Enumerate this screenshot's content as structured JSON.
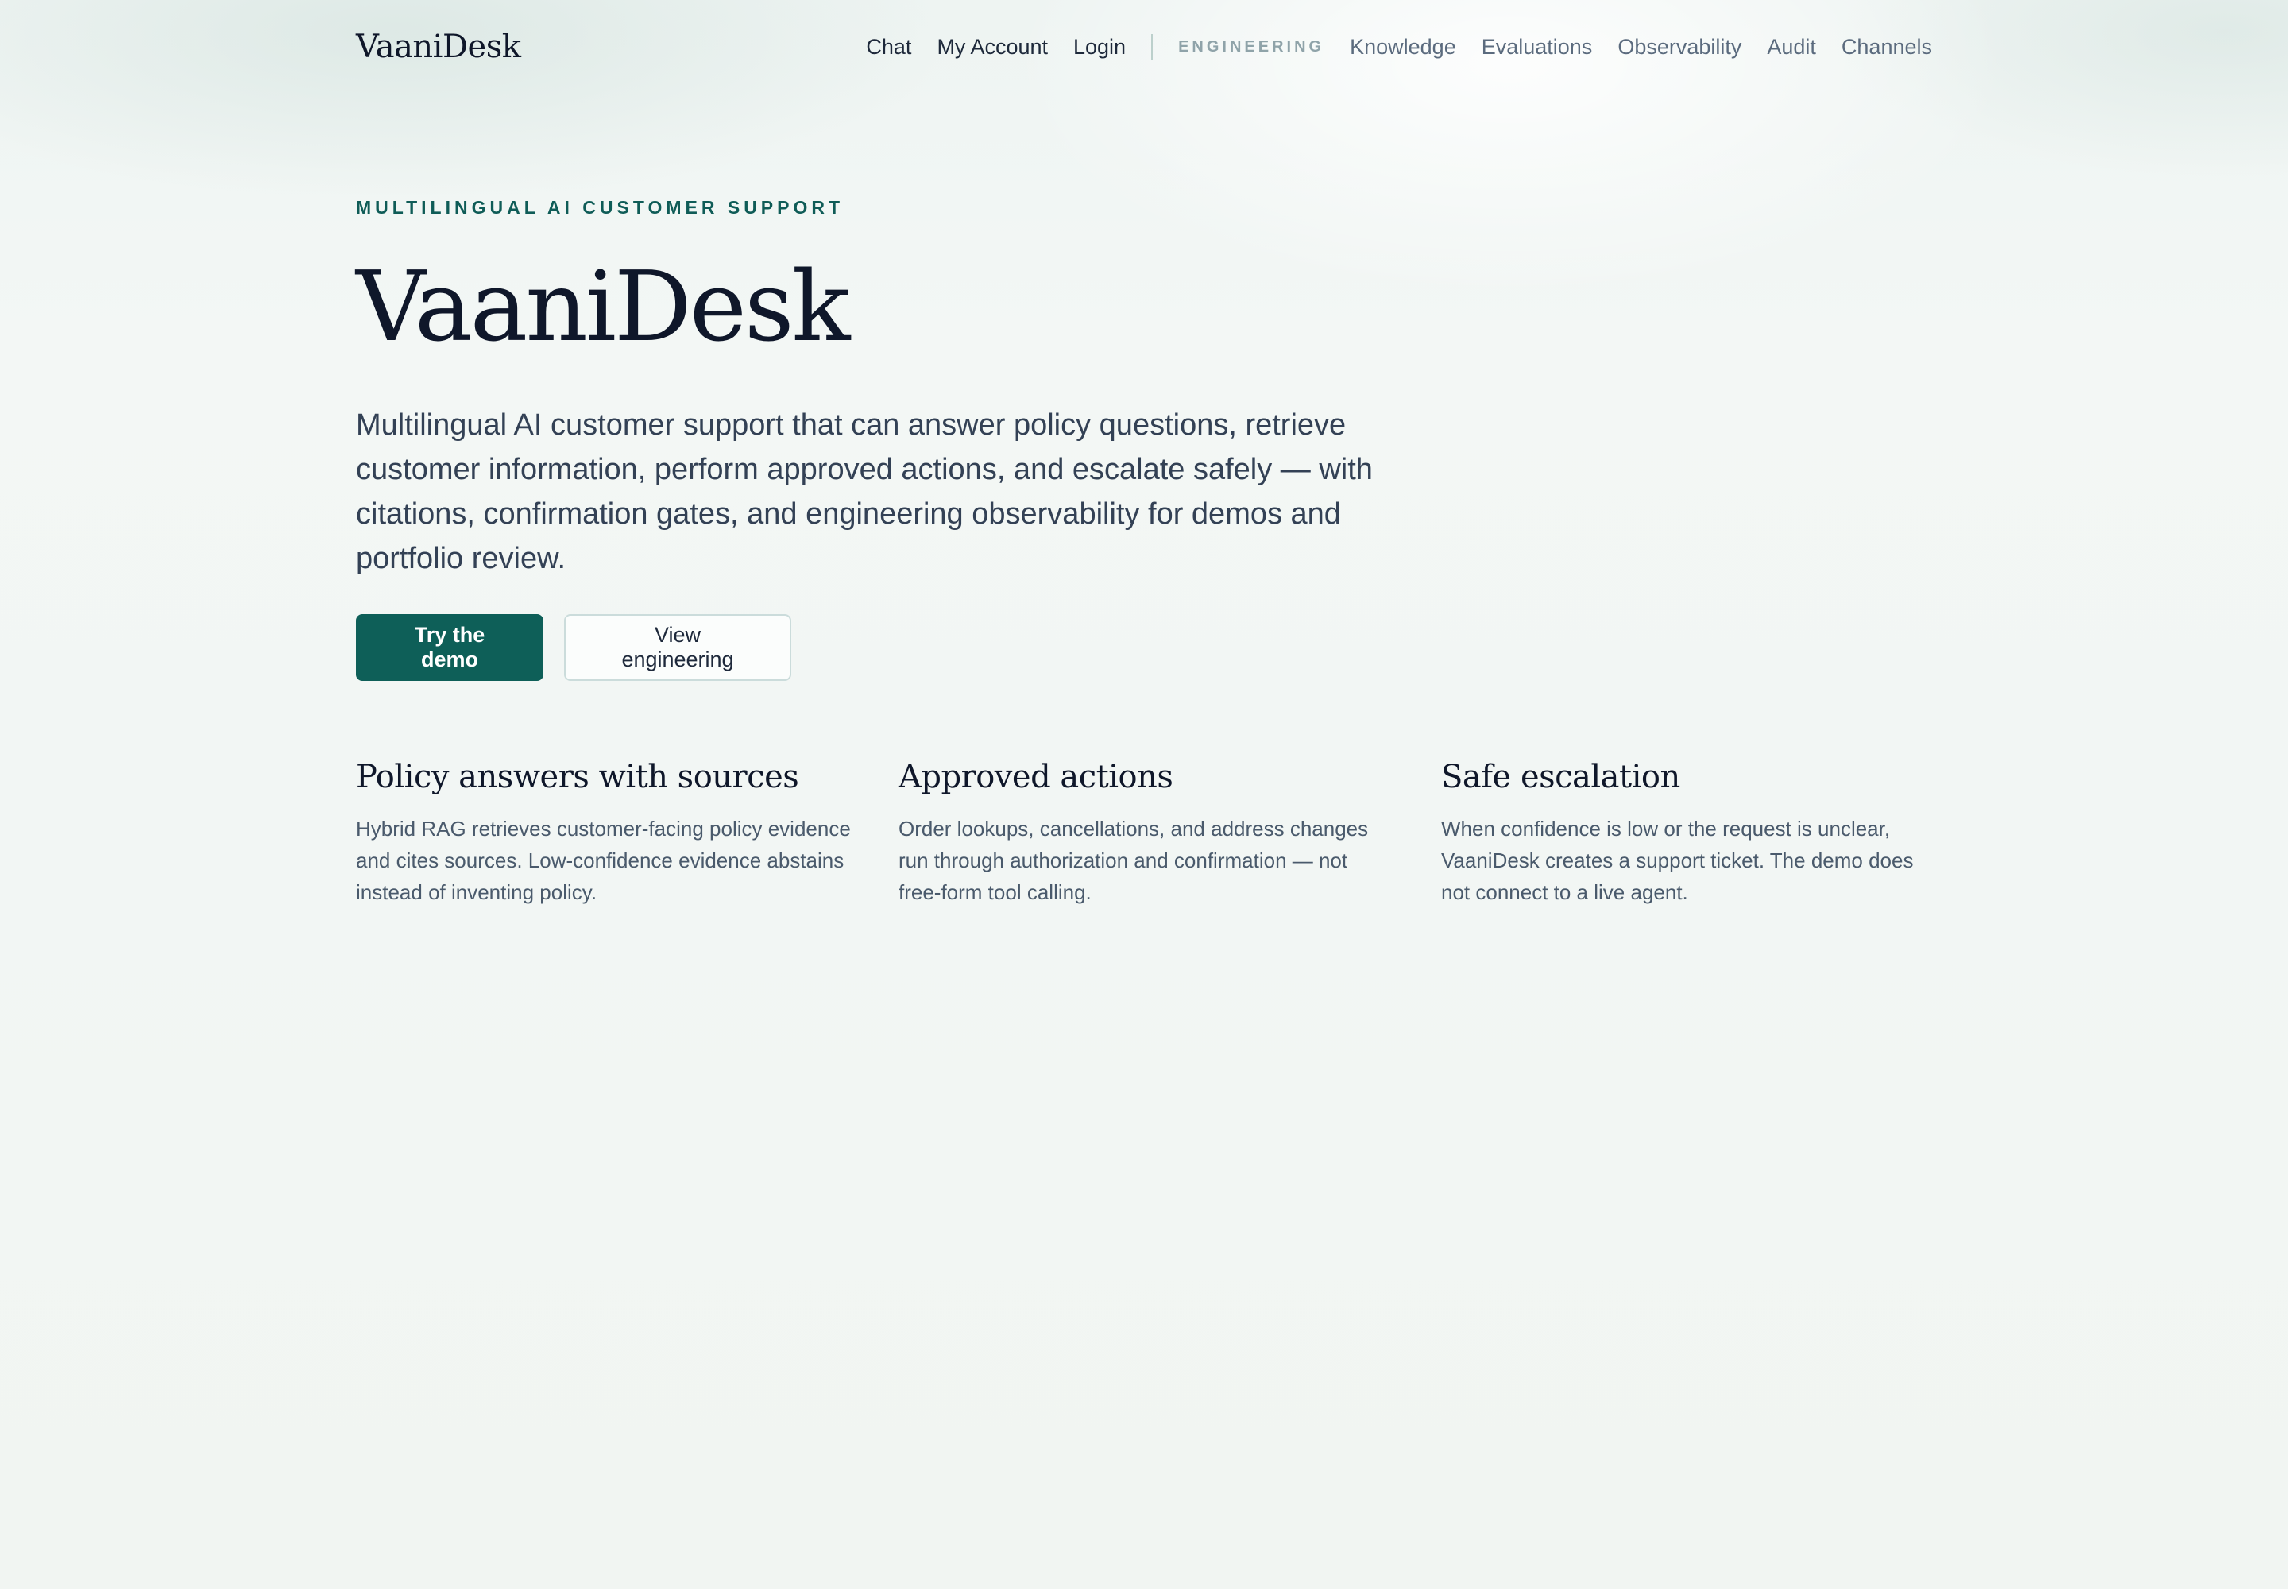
{
  "brand": "VaaniDesk",
  "nav": {
    "primary": [
      "Chat",
      "My Account",
      "Login"
    ],
    "group_label": "ENGINEERING",
    "secondary": [
      "Knowledge",
      "Evaluations",
      "Observability",
      "Audit",
      "Channels"
    ]
  },
  "hero": {
    "eyebrow": "MULTILINGUAL AI CUSTOMER SUPPORT",
    "title": "VaaniDesk",
    "lead": "Multilingual AI customer support that can answer policy questions, retrieve customer information, perform approved actions, and escalate safely — with citations, confirmation gates, and engineering observability for demos and portfolio review.",
    "cta_primary": "Try the demo",
    "cta_secondary": "View engineering"
  },
  "features": [
    {
      "title": "Policy answers with sources",
      "body": "Hybrid RAG retrieves customer-facing policy evidence and cites sources. Low-confidence evidence abstains instead of inventing policy."
    },
    {
      "title": "Approved actions",
      "body": "Order lookups, cancellations, and address changes run through authorization and confirmation — not free-form tool calling."
    },
    {
      "title": "Safe escalation",
      "body": "When confidence is low or the request is unclear, VaaniDesk creates a support ticket. The demo does not connect to a live agent."
    }
  ],
  "colors": {
    "accent": "#0e5f58",
    "eyebrow": "#0f5c57",
    "heading": "#0f172a",
    "body_text": "#334155"
  }
}
